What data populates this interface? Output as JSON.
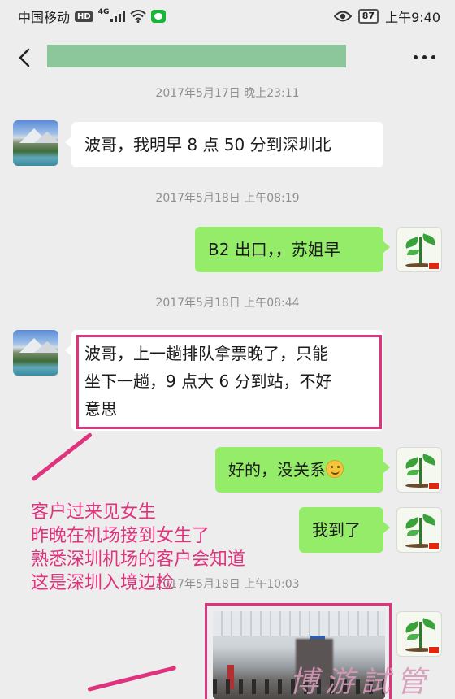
{
  "status_bar": {
    "carrier": "中国移动",
    "hd_badge": "HD",
    "network": "4G",
    "battery": "87",
    "time": "上午9:40"
  },
  "nav": {
    "back_icon": "chevron-left-icon",
    "more_icon": "more-dots-icon",
    "title_redaction_color": "#8cc79c"
  },
  "messages": [
    {
      "timestamp": "2017年5月17日 晚上23:11"
    },
    {
      "side": "left",
      "lines": [
        "波哥，我明早 8 点 50 分到深圳北"
      ]
    },
    {
      "timestamp": "2017年5月18日 上午08:19"
    },
    {
      "side": "right",
      "lines": [
        "B2 出口，，苏姐早"
      ]
    },
    {
      "timestamp": "2017年5月18日 上午08:44"
    },
    {
      "side": "left",
      "lines": [
        "波哥，上一趟排队拿票晚了，只能",
        "坐下一趟，9 点大 6 分到站，不好",
        "意思"
      ]
    },
    {
      "side": "right",
      "lines": [
        "好的，没关系"
      ],
      "emoji": "smile-emoji"
    },
    {
      "side": "right",
      "lines": [
        "我到了"
      ]
    },
    {
      "timestamp": "2017年5月18日 上午10:03"
    },
    {
      "side": "right",
      "type": "image"
    }
  ],
  "annotation": {
    "lines": [
      "客户过来见女生",
      "昨晚在机场接到女生了",
      "熟悉深圳机场的客户会知道",
      "这是深圳入境边检"
    ],
    "color": "#e0337e"
  },
  "watermark": "博游試管",
  "colors": {
    "background": "#ededed",
    "bubble_self": "#95ec69",
    "bubble_other": "#ffffff",
    "highlight": "#e0337e"
  }
}
